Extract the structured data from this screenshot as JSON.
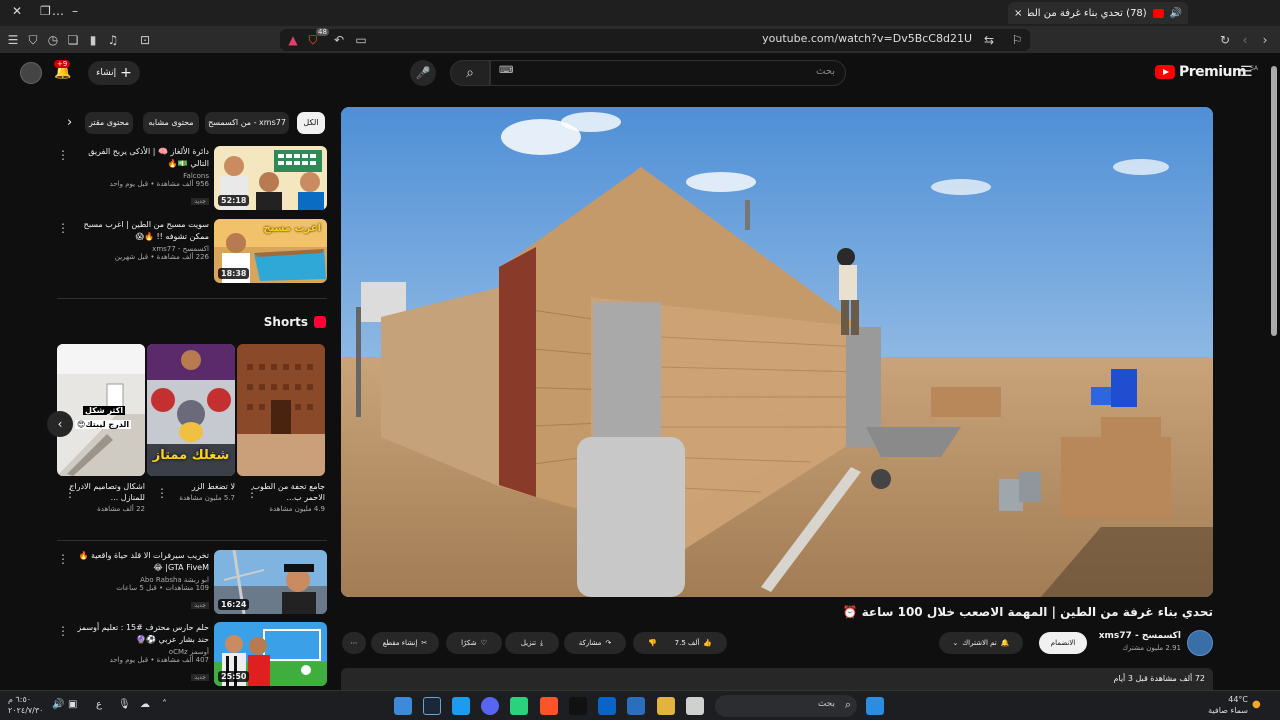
{
  "browser": {
    "tab_title": "(78) تحدي بناء غرفة من الطين",
    "url": "youtube.com/watch?v=Dv5BcC8d21U",
    "shield_count": "48",
    "new_tab": "+",
    "close_tab": "×",
    "min": "–",
    "dots": "…"
  },
  "yt": {
    "logo_word": "Premium",
    "logo_region": "SA",
    "search_placeholder": "بحث",
    "create_label": "إنشاء",
    "notif_badge": "+9"
  },
  "chips": [
    {
      "label": "الكل",
      "active": true
    },
    {
      "label": "من اكسمسح - xms77",
      "active": false
    },
    {
      "label": "محتوى مشابه",
      "active": false
    },
    {
      "label": "محتوى مقتر",
      "active": false
    }
  ],
  "recs": [
    {
      "title": "دائرة الألغاز 🧠 | الأذكى يربح الفريق التالي 💵🔥",
      "channel": "Falcons",
      "views": "956 ألف مشاهدة • قبل يوم واحد",
      "badge": "جديد",
      "duration": "52:18"
    },
    {
      "title": "سويت مسبح من الطين | اغرب مسبح ممكن تشوفه !! 🔥😱",
      "channel": "اكسمسح - xms77",
      "views": "226 ألف مشاهدة • قبل شهرين",
      "badge": "",
      "duration": "18:38"
    },
    {
      "title": "تخريب سيرفرات الا قلد حياة واقعية 🔥 GTA FiveM| 😂",
      "channel": "ابو ربشة Abo Rabsha",
      "views": "109 مشاهدات • قبل 5 ساعات",
      "badge": "جديد",
      "duration": "16:24"
    },
    {
      "title": "حلم حارس محترف #15 : تعليم أوسمز حند بشار عربي ⚽🔮",
      "channel": "أوسمز oCMz",
      "views": "407 ألف مشاهدة • قبل يوم واحد",
      "badge": "جديد",
      "duration": "25:50"
    }
  ],
  "thumb_text": {
    "rec2": "اغرب مسبح",
    "short3_a": "اكثر شكل",
    "short3_b": "الدرج ليبتك😍",
    "short2": "شغلك ممتاز"
  },
  "shorts": {
    "heading": "Shorts",
    "items": [
      {
        "title": "جامع تحفة من الطوب الاحمر ب...",
        "views": "4.9 مليون مشاهدة"
      },
      {
        "title": "لا تضغط الزر",
        "views": "5.7 مليون مشاهدة"
      },
      {
        "title": "اشكال وتصاميم الادراج للمنازل ...",
        "views": "22 ألف مشاهدة"
      }
    ]
  },
  "video": {
    "title": "تحدي بناء غرفة من الطين | المهمة الاصعب خلال 100 ساعة ⏰",
    "channel": "اكسمسح - xms77",
    "subs": "2.91 مليون مشترك",
    "join": "الانضمام",
    "subscribed": "تم الاشتراك",
    "likes": "7.5 ألف",
    "share": "مشاركة",
    "download": "تنزيل",
    "thanks": "شكرًا",
    "clip": "إنشاء مقطع",
    "desc_stats": "72 ألف مشاهدة  قبل 3 أيام"
  },
  "taskbar": {
    "search": "بحث",
    "weather_temp": "44°C",
    "weather_desc": "سماء صافية",
    "time": "٦:٥٠ م",
    "date": "٢٠٢٤/٧/٣٠",
    "lang": "ع"
  },
  "colors": {
    "accent": "#ff0000",
    "bg": "#0f0f0f",
    "chip": "#272727"
  }
}
